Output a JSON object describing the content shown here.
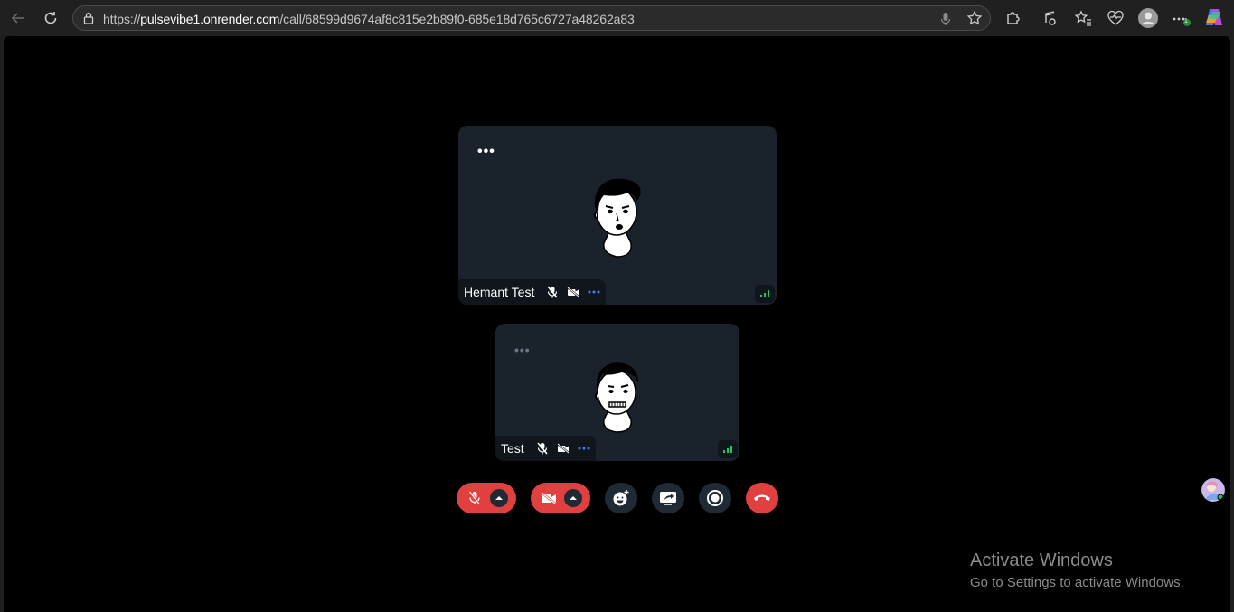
{
  "browser": {
    "url_prefix": "https://",
    "url_host": "pulsevibe1.onrender.com",
    "url_path": "/call/68599d9674af8c815e2b89f0-685e18d765c6727a48262a83",
    "notification_count": "1"
  },
  "participants": [
    {
      "name": "Hemant Test",
      "menu": "•••",
      "mic": "muted",
      "camera": "off"
    },
    {
      "name": "Test",
      "menu": "•••",
      "mic": "muted",
      "camera": "off"
    }
  ],
  "controls": {
    "mic": {
      "state": "muted",
      "color": "#e0403f"
    },
    "camera": {
      "state": "off",
      "color": "#e0403f"
    },
    "reactions": "emoji-add-icon",
    "share_screen": "screen-share-icon",
    "record": "record-icon",
    "leave": {
      "icon": "hang-up-icon",
      "color": "#e0403f"
    }
  },
  "colors": {
    "page_bg": "#000000",
    "tile_bg": "#1a222b",
    "accent_blue": "#3b82f6",
    "signal_green": "#22c55e",
    "danger": "#e0403f"
  },
  "watermark": {
    "title": "Activate Windows",
    "subtitle": "Go to Settings to activate Windows."
  }
}
